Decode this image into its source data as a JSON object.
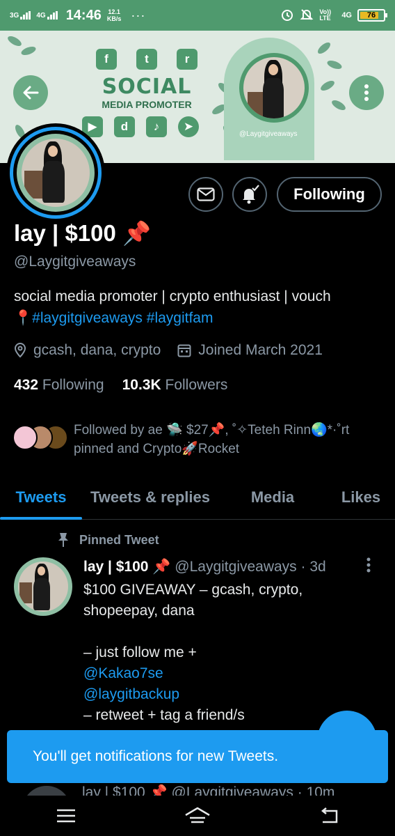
{
  "status_bar": {
    "net1": "3G",
    "net2": "4G",
    "time": "14:46",
    "speed_value": "12.1",
    "speed_unit": "KB/s",
    "more": "···",
    "volte": "Vo)) LTE",
    "net3": "4G",
    "battery": "76",
    "battery_color": "#e8b923"
  },
  "banner": {
    "title_line1": "SOCIAL",
    "title_line2": "MEDIA PROMOTER",
    "handle": "@Laygitgiveaways",
    "top_icons": [
      "f",
      "t",
      "r"
    ],
    "bottom_icons": [
      "▶",
      "d",
      "♪",
      "➤"
    ]
  },
  "profile": {
    "name": "lay | $100 📌",
    "handle": "@Laygitgiveaways",
    "bio_text": "social media promoter | crypto enthusiast | vouch",
    "bio_pin": "📍",
    "bio_tag1": "#laygitgiveaways",
    "bio_tag2": "#laygitfam",
    "location": "gcash, dana, crypto",
    "joined": "Joined March 2021",
    "following_count": "432",
    "following_label": "Following",
    "followers_count": "10.3K",
    "followers_label": "Followers",
    "followed_by": "Followed by ae 🛸 $27📌, ˚✧Teteh Rinn🌏*·˚rt pinned and Crypto🚀Rocket",
    "follow_button": "Following",
    "accent": "#1d9bf0"
  },
  "tabs": [
    {
      "label": "Tweets"
    },
    {
      "label": "Tweets & replies"
    },
    {
      "label": "Media"
    },
    {
      "label": "Likes"
    }
  ],
  "tweet": {
    "pinned_label": "Pinned Tweet",
    "author": "lay | $100 📌",
    "handle_time": "@Laygitgiveaways · 3d",
    "line1": "$100 GIVEAWAY – gcash, crypto,",
    "line2": "shopeepay, dana",
    "line3": "– just follow me +",
    "mention1": "@Kakao7se",
    "mention2": "@laygitbackup",
    "line4": "– retweet + tag a friend/s"
  },
  "peek_tweet": {
    "text": "lay | $100 📌 @Laygitgiveaways · 10m"
  },
  "toast": {
    "text": "You'll get notifications for new Tweets."
  }
}
